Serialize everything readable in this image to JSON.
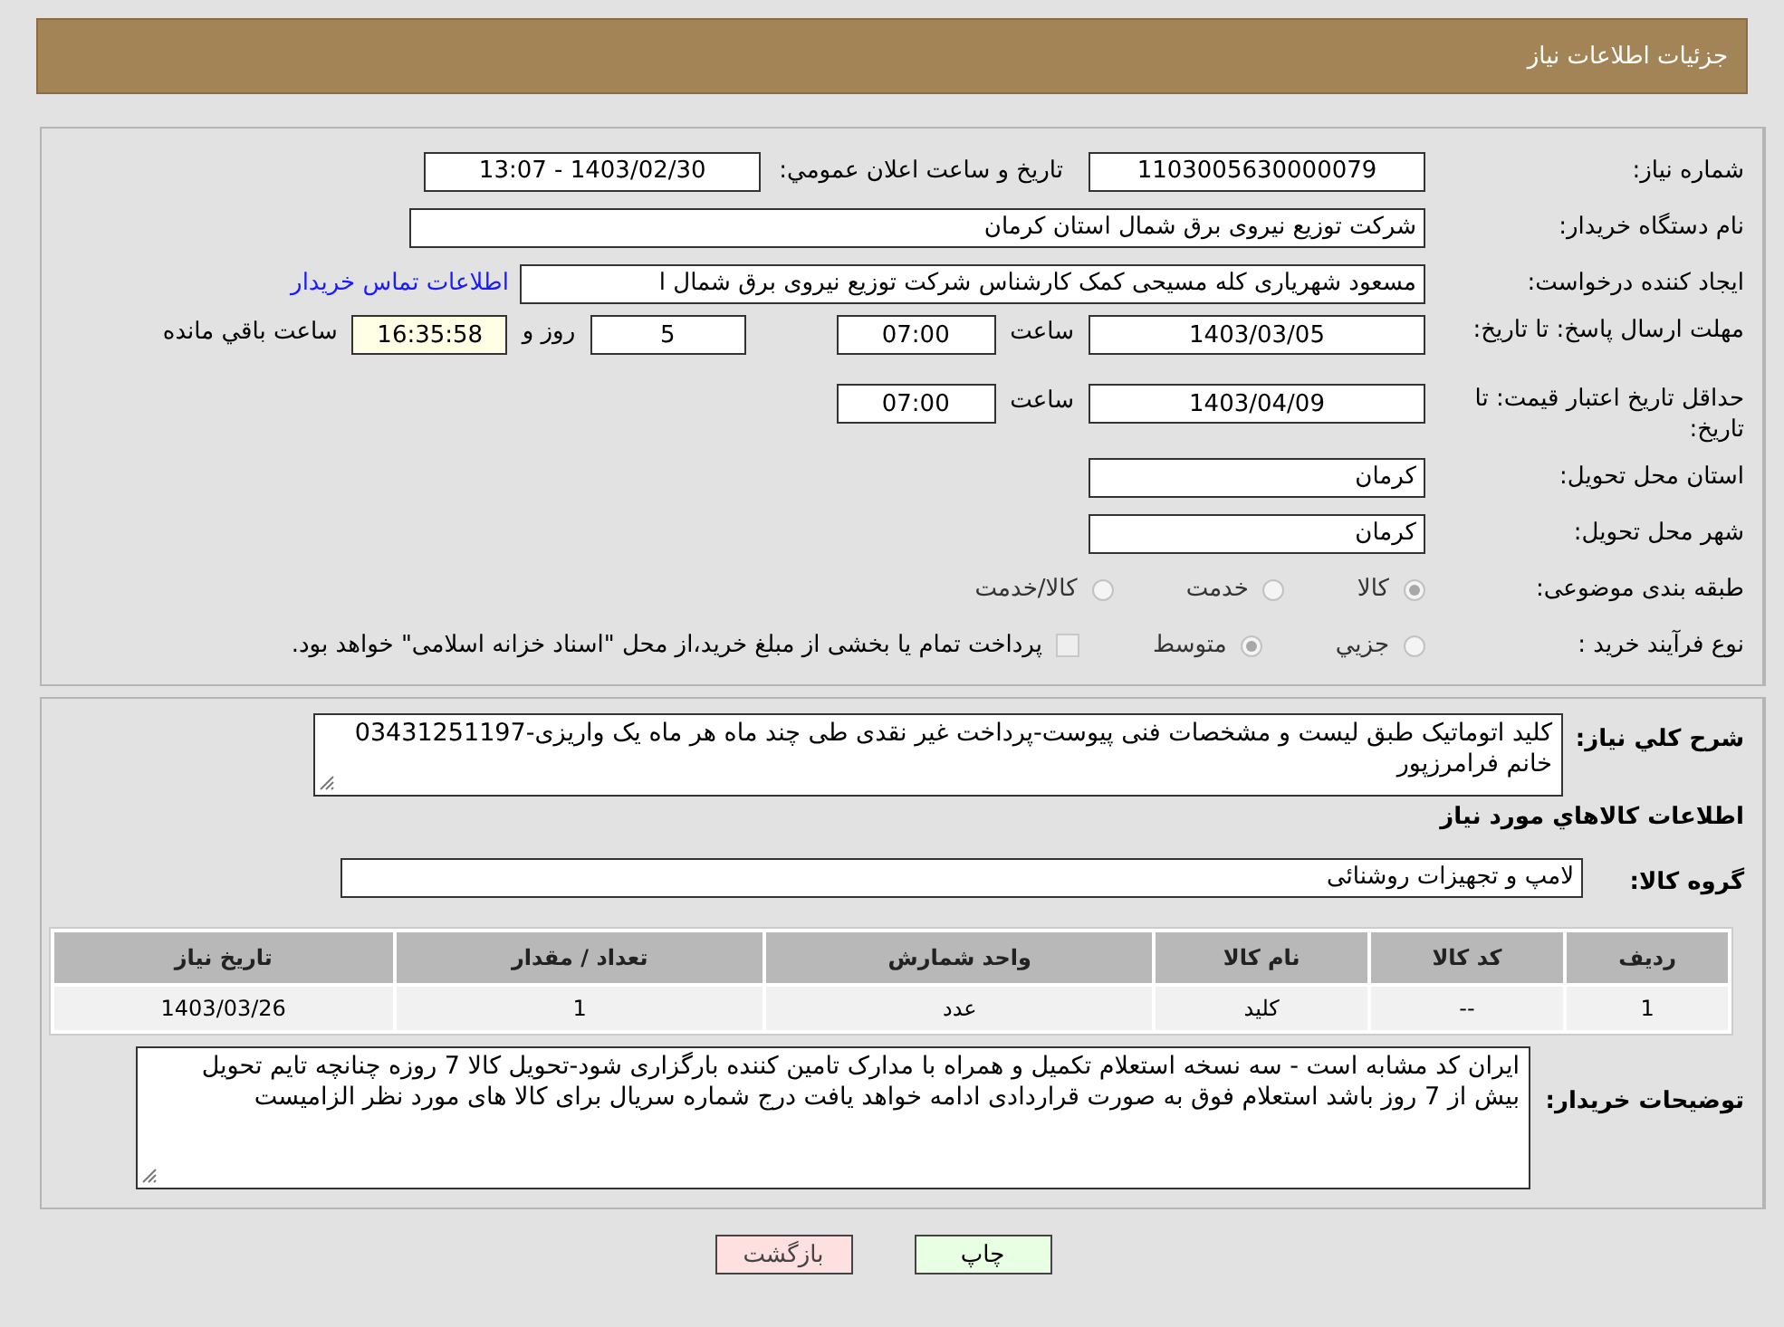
{
  "header": {
    "title": "جزئیات اطلاعات نیاز"
  },
  "fields": {
    "need_number": {
      "label": "شماره نیاز:",
      "value": "1103005630000079"
    },
    "announce": {
      "label": "تاریخ و ساعت اعلان عمومي:",
      "value": "1403/02/30 - 13:07"
    },
    "buyer": {
      "label": "نام دستگاه خریدار:",
      "value": "شرکت توزیع نیروی برق شمال استان کرمان"
    },
    "requester": {
      "label": "ایجاد کننده درخواست:",
      "value": "مسعود شهریاری کله مسیحی کمک کارشناس شرکت توزیع نیروی برق شمال ا",
      "link": "اطلاعات تماس خریدار"
    },
    "deadline": {
      "label": "مهلت ارسال پاسخ: تا تاریخ:",
      "date": "1403/03/05",
      "time_label": "ساعت",
      "time": "07:00",
      "days": "5",
      "days_label": "روز و",
      "remaining": "16:35:58",
      "remaining_label": "ساعت باقي مانده"
    },
    "validity": {
      "label": "حداقل تاریخ اعتبار قیمت: تا تاریخ:",
      "date": "1403/04/09",
      "time_label": "ساعت",
      "time": "07:00"
    },
    "province": {
      "label": "استان محل تحویل:",
      "value": "کرمان"
    },
    "city": {
      "label": "شهر محل تحویل:",
      "value": "کرمان"
    },
    "category": {
      "label": "طبقه بندی موضوعی:",
      "options": [
        {
          "label": "کالا",
          "selected": true
        },
        {
          "label": "خدمت",
          "selected": false
        },
        {
          "label": "کالا/خدمت",
          "selected": false
        }
      ]
    },
    "process": {
      "label": "نوع فرآیند خرید :",
      "options": [
        {
          "label": "جزيي",
          "selected": false
        },
        {
          "label": "متوسط",
          "selected": true
        }
      ],
      "payment_checked": false,
      "note": "پرداخت تمام یا بخشی از مبلغ خرید،از محل \"اسناد خزانه اسلامی\" خواهد بود."
    }
  },
  "description": {
    "label": "شرح کلي نیاز:",
    "value": "کلید اتوماتیک طبق لیست و مشخصات فنی پیوست-پرداخت غیر نقدی طی چند ماه هر ماه یک واریزی-03431251197 خانم فرامرزپور"
  },
  "goods_title": "اطلاعات کالاهاي مورد نیاز",
  "group": {
    "label": "گروه کالا:",
    "value": "لامپ و تجهیزات روشنائی"
  },
  "table": {
    "columns": [
      "ردیف",
      "کد کالا",
      "نام کالا",
      "واحد شمارش",
      "تعداد / مقدار",
      "تاریخ نیاز"
    ],
    "rows": [
      [
        "1",
        "--",
        "کلید",
        "عدد",
        "1",
        "1403/03/26"
      ]
    ]
  },
  "notes": {
    "label": "توضیحات خریدار:",
    "value": "ایران کد مشابه است - سه نسخه استعلام تکمیل و همراه با مدارک تامین کننده بارگزاری شود-تحویل کالا 7 روزه چنانچه تایم تحویل بیش از 7 روز باشد استعلام فوق به صورت قراردادی ادامه خواهد یافت  درج شماره سریال برای کالا های مورد نظر الزامیست"
  },
  "buttons": [
    {
      "label": "چاپ",
      "kind": "print"
    },
    {
      "label": "بازگشت",
      "kind": "back"
    }
  ]
}
